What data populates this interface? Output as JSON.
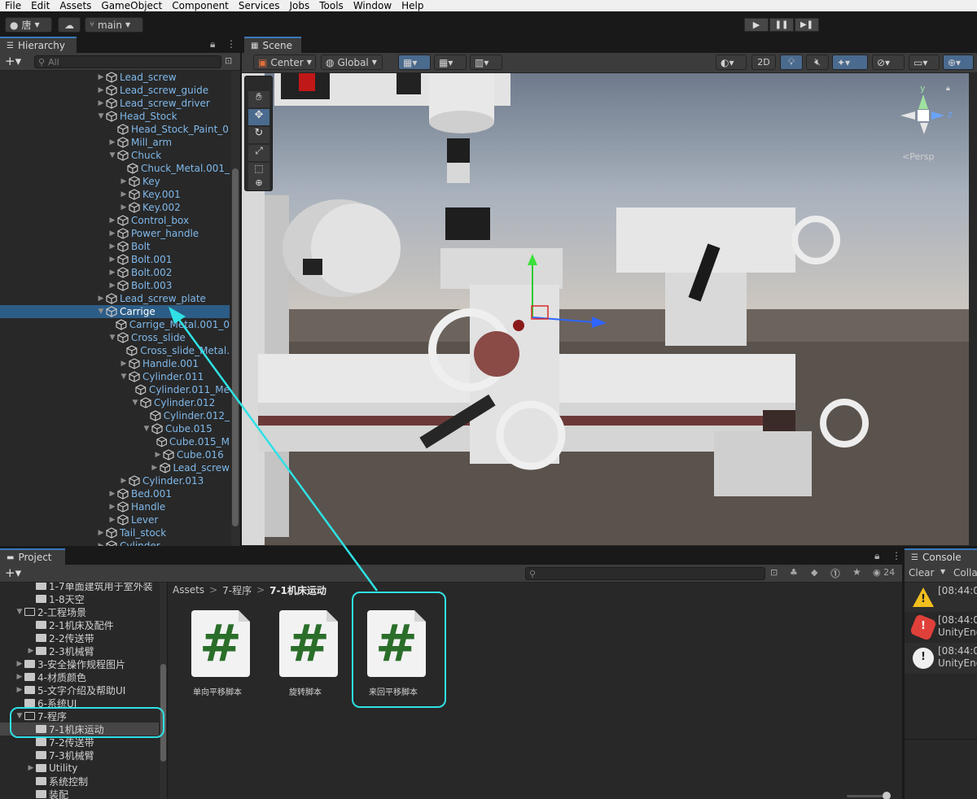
{
  "menu": [
    "File",
    "Edit",
    "Assets",
    "GameObject",
    "Component",
    "Services",
    "Jobs",
    "Tools",
    "Window",
    "Help"
  ],
  "toolbar": {
    "account": "唐",
    "branch": "main"
  },
  "hierarchy": {
    "tab": "Hierarchy",
    "search_placeholder": "All",
    "rows": [
      {
        "label": "Lead_screw",
        "indent": 0,
        "fold": "right"
      },
      {
        "label": "Lead_screw_guide",
        "indent": 0,
        "fold": "right"
      },
      {
        "label": "Lead_screw_driver",
        "indent": 0,
        "fold": "right"
      },
      {
        "label": "Head_Stock",
        "indent": 0,
        "fold": "down"
      },
      {
        "label": "Head_Stock_Paint_0",
        "indent": 1,
        "fold": ""
      },
      {
        "label": "Mill_arm",
        "indent": 1,
        "fold": "right"
      },
      {
        "label": "Chuck",
        "indent": 1,
        "fold": "down"
      },
      {
        "label": "Chuck_Metal.001_",
        "indent": 2,
        "fold": ""
      },
      {
        "label": "Key",
        "indent": 2,
        "fold": "right"
      },
      {
        "label": "Key.001",
        "indent": 2,
        "fold": "right"
      },
      {
        "label": "Key.002",
        "indent": 2,
        "fold": "right"
      },
      {
        "label": "Control_box",
        "indent": 1,
        "fold": "right"
      },
      {
        "label": "Power_handle",
        "indent": 1,
        "fold": "right"
      },
      {
        "label": "Bolt",
        "indent": 1,
        "fold": "right"
      },
      {
        "label": "Bolt.001",
        "indent": 1,
        "fold": "right"
      },
      {
        "label": "Bolt.002",
        "indent": 1,
        "fold": "right"
      },
      {
        "label": "Bolt.003",
        "indent": 1,
        "fold": "right"
      },
      {
        "label": "Lead_screw_plate",
        "indent": 0,
        "fold": "right"
      },
      {
        "label": "Carrige",
        "indent": 0,
        "fold": "down",
        "selected": true
      },
      {
        "label": "Carrige_Metal.001_0",
        "indent": 1,
        "fold": ""
      },
      {
        "label": "Cross_slide",
        "indent": 1,
        "fold": "down"
      },
      {
        "label": "Cross_slide_Metal.",
        "indent": 2,
        "fold": ""
      },
      {
        "label": "Handle.001",
        "indent": 2,
        "fold": "right"
      },
      {
        "label": "Cylinder.011",
        "indent": 2,
        "fold": "down"
      },
      {
        "label": "Cylinder.011_Me",
        "indent": 3,
        "fold": ""
      },
      {
        "label": "Cylinder.012",
        "indent": 3,
        "fold": "down"
      },
      {
        "label": "Cylinder.012_",
        "indent": 4,
        "fold": ""
      },
      {
        "label": "Cube.015",
        "indent": 4,
        "fold": "down"
      },
      {
        "label": "Cube.015_M",
        "indent": 5,
        "fold": ""
      },
      {
        "label": "Cube.016",
        "indent": 5,
        "fold": "right"
      },
      {
        "label": "Lead_screw",
        "indent": 5,
        "fold": "right"
      },
      {
        "label": "Cylinder.013",
        "indent": 2,
        "fold": "right"
      },
      {
        "label": "Bed.001",
        "indent": 1,
        "fold": "right"
      },
      {
        "label": "Handle",
        "indent": 1,
        "fold": "right"
      },
      {
        "label": "Lever",
        "indent": 1,
        "fold": "right"
      },
      {
        "label": "Tail_stock",
        "indent": 0,
        "fold": "right"
      },
      {
        "label": "Cylinder",
        "indent": 0,
        "fold": "right"
      }
    ]
  },
  "scene": {
    "tab": "Scene",
    "pivot": "Center",
    "space": "Global",
    "mode_2d": "2D",
    "persp": "<Persp",
    "axis_y": "y",
    "axis_z": "z"
  },
  "project": {
    "tab": "Project",
    "count": "24",
    "breadcrumb": [
      "Assets",
      "7-程序",
      "7-1机床运动"
    ],
    "tree": [
      {
        "label": "1-7单面建筑用于室外装",
        "indent": 1,
        "fold": ""
      },
      {
        "label": "1-8天空",
        "indent": 1,
        "fold": ""
      },
      {
        "label": "2-工程场景",
        "indent": 0,
        "fold": "down",
        "open": true
      },
      {
        "label": "2-1机床及配件",
        "indent": 1,
        "fold": ""
      },
      {
        "label": "2-2传送带",
        "indent": 1,
        "fold": ""
      },
      {
        "label": "2-3机械臂",
        "indent": 1,
        "fold": "right"
      },
      {
        "label": "3-安全操作规程图片",
        "indent": 0,
        "fold": "right"
      },
      {
        "label": "4-材质颜色",
        "indent": 0,
        "fold": "right"
      },
      {
        "label": "5-文字介绍及帮助UI",
        "indent": 0,
        "fold": "right"
      },
      {
        "label": "6-系统UI",
        "indent": 0,
        "fold": ""
      },
      {
        "label": "7-程序",
        "indent": 0,
        "fold": "down",
        "open": true
      },
      {
        "label": "7-1机床运动",
        "indent": 1,
        "fold": "",
        "selected": true
      },
      {
        "label": "7-2传送带",
        "indent": 1,
        "fold": ""
      },
      {
        "label": "7-3机械臂",
        "indent": 1,
        "fold": ""
      },
      {
        "label": "Utility",
        "indent": 1,
        "fold": "right"
      },
      {
        "label": "系统控制",
        "indent": 1,
        "fold": ""
      },
      {
        "label": "装配",
        "indent": 1,
        "fold": ""
      }
    ],
    "assets": [
      {
        "label": "单向平移脚本",
        "glyph": "#"
      },
      {
        "label": "旋转脚本",
        "glyph": "#"
      },
      {
        "label": "来回平移脚本",
        "glyph": "#"
      }
    ]
  },
  "console": {
    "tab": "Console",
    "clear": "Clear",
    "collapse": "Colla",
    "entries": [
      {
        "time": "[08:44:0",
        "source": "",
        "level": "warning"
      },
      {
        "time": "[08:44:0",
        "source": "UnityEng",
        "level": "error"
      },
      {
        "time": "[08:44:0",
        "source": "UnityEng",
        "level": "info"
      }
    ]
  },
  "colors": {
    "accent": "#2fe1e4",
    "selection": "#2c5d87",
    "script_hash": "#2a6e2a"
  }
}
